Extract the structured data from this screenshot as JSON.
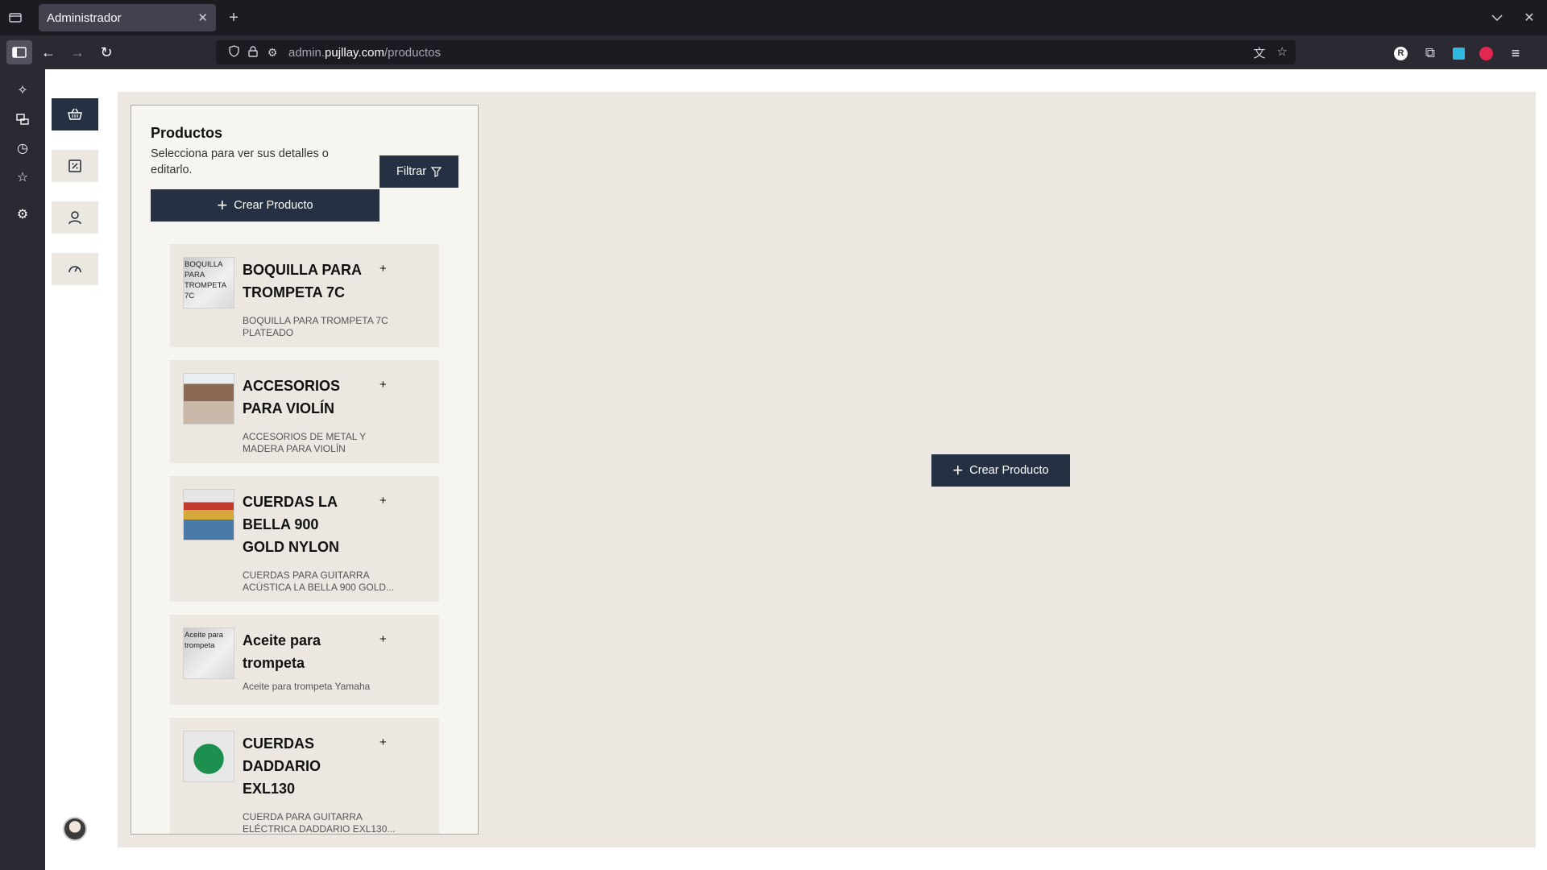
{
  "browser": {
    "tab_title": "Administrador",
    "url_domain": "admin.",
    "url_host": "pujllay.com",
    "url_path": "/productos"
  },
  "panel": {
    "title": "Productos",
    "subtitle": "Selecciona para ver sus detalles o editarlo.",
    "filter_label": "Filtrar",
    "create_label": "Crear Producto"
  },
  "products": [
    {
      "title": "BOQUILLA PARA TROMPETA 7C",
      "desc": "BOQUILLA PARA TROMPETA 7C PLATEADO",
      "thumb_text": "BOQUILLA PARA TROMPETA 7C"
    },
    {
      "title": "ACCESORIOS PARA VIOLÍN",
      "desc": "ACCESORIOS DE METAL Y MADERA PARA VIOLÍN",
      "thumb_text": ""
    },
    {
      "title": "CUERDAS LA BELLA 900 GOLD NYLON",
      "desc": "CUERDAS PARA GUITARRA ACÚSTICA LA BELLA 900 GOLD...",
      "thumb_text": ""
    },
    {
      "title": "Aceite para trompeta",
      "desc": "Aceite para trompeta Yamaha",
      "thumb_text": "Aceite para trompeta"
    },
    {
      "title": "CUERDAS DADDARIO EXL130",
      "desc": "CUERDA PARA GUITARRA ELÉCTRICA DADDARIO EXL130...",
      "thumb_text": ""
    }
  ],
  "main": {
    "create_label": "Crear Producto"
  },
  "colors": {
    "primary": "#253143",
    "panel_bg": "#ece8e1"
  }
}
